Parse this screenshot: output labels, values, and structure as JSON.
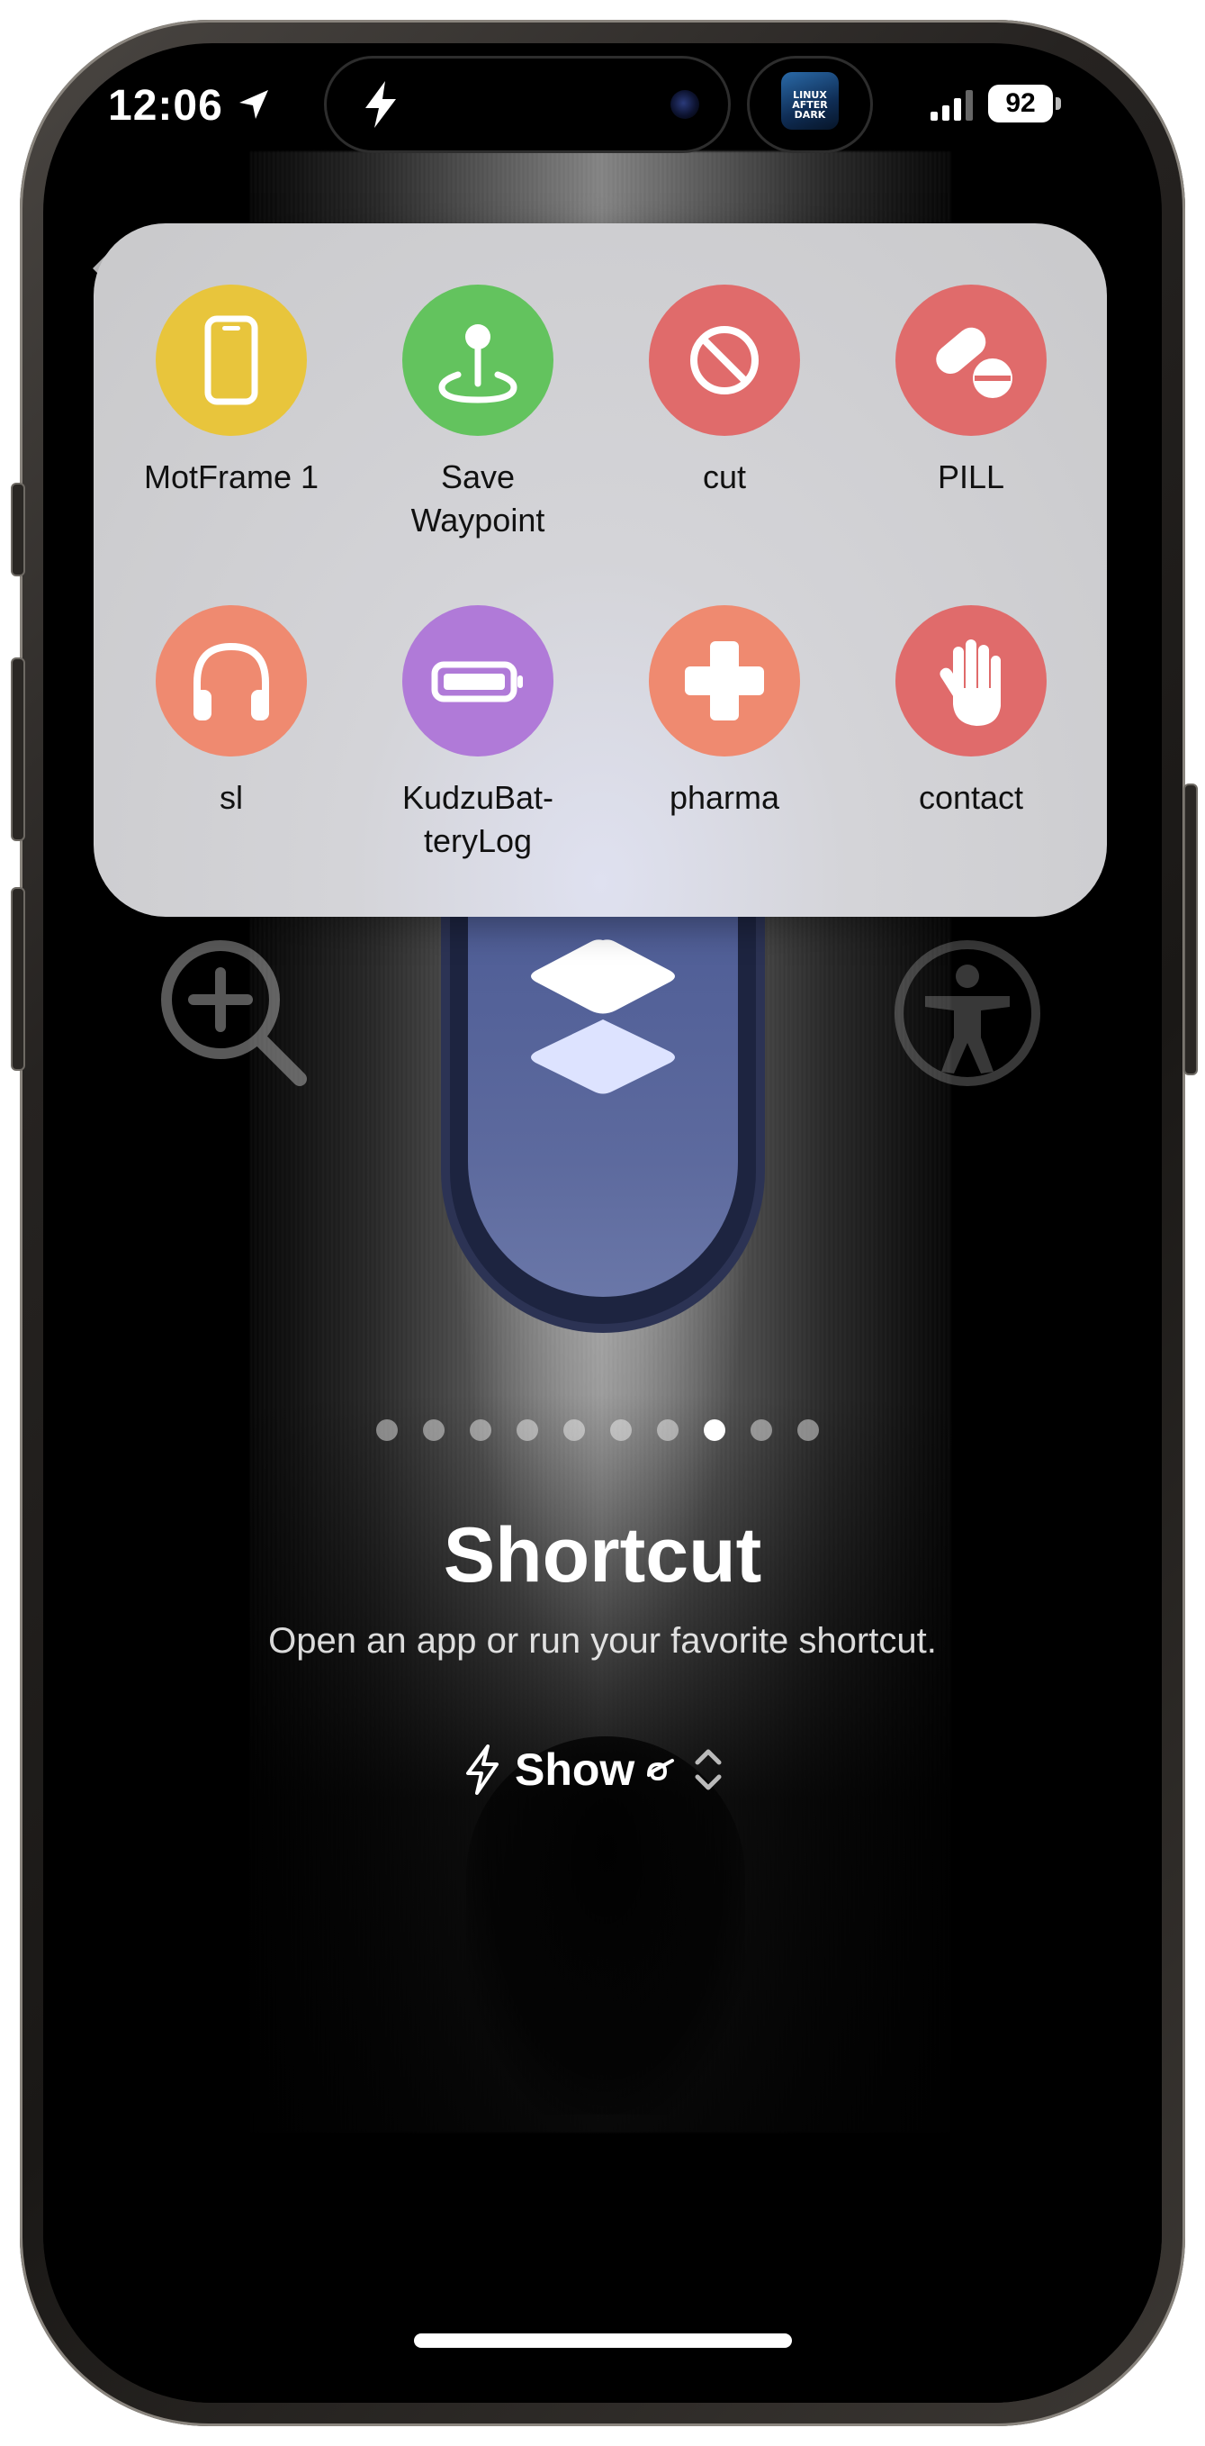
{
  "status_bar": {
    "time": "12:06",
    "battery": "92",
    "now_playing_art_text": [
      "LINUX",
      "AFTER",
      "DARK"
    ]
  },
  "shortcuts_menu": {
    "items": [
      {
        "label": "MotFrame 1",
        "icon": "iphone-icon",
        "color": "#e8c53c"
      },
      {
        "label": "Save\nWaypoint",
        "icon": "waypoint-icon",
        "color": "#63c35e"
      },
      {
        "label": "cut",
        "icon": "prohibited-icon",
        "color": "#e06b6b"
      },
      {
        "label": "PILL",
        "icon": "pills-icon",
        "color": "#e06b6b"
      },
      {
        "label": "sl",
        "icon": "headphones-icon",
        "color": "#ef8a70"
      },
      {
        "label": "KudzuBat-\nteryLog",
        "icon": "battery-icon",
        "color": "#b07ad8"
      },
      {
        "label": "pharma",
        "icon": "cross-icon",
        "color": "#ef8a70"
      },
      {
        "label": "contact",
        "icon": "hand-icon",
        "color": "#e06b6b"
      }
    ]
  },
  "pager": {
    "count": 10,
    "active_index": 7
  },
  "mode": {
    "title": "Shortcut",
    "description": "Open an app or run your favorite shortcut.",
    "selector_label": "Show"
  }
}
